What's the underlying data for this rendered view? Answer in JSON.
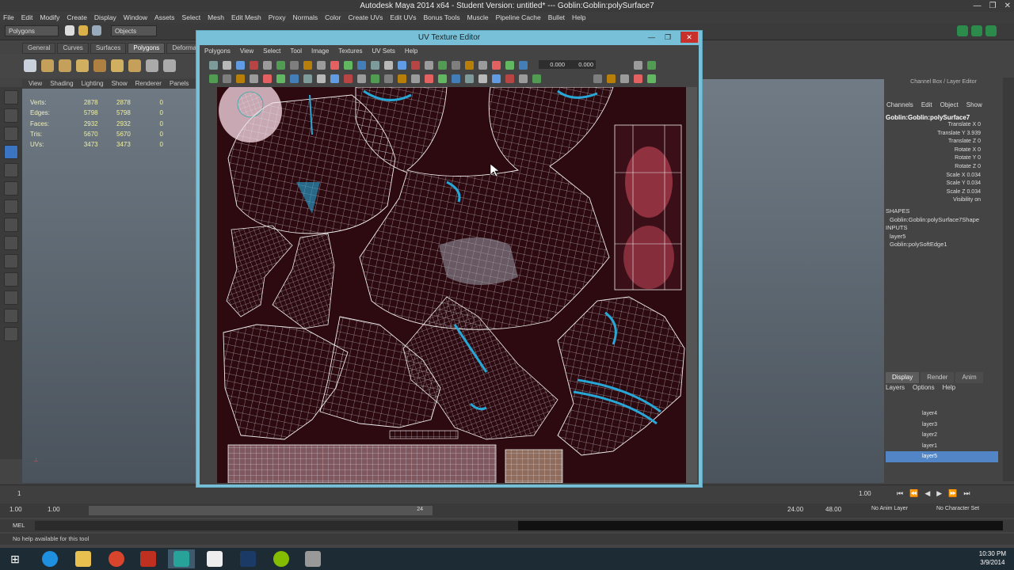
{
  "app": {
    "title": "Autodesk Maya 2014 x64 - Student Version: untitled*   ---   Goblin:Goblin:polySurface7"
  },
  "menubar": [
    "File",
    "Edit",
    "Modify",
    "Create",
    "Display",
    "Window",
    "Assets",
    "Select",
    "Mesh",
    "Edit Mesh",
    "Proxy",
    "Normals",
    "Color",
    "Create UVs",
    "Edit UVs",
    "Bonus Tools",
    "Muscle",
    "Pipeline Cache",
    "Bullet",
    "Help"
  ],
  "statusline": {
    "mode": "Polygons",
    "objects_label": "Objects"
  },
  "shelf_tabs": [
    "General",
    "Curves",
    "Surfaces",
    "Polygons",
    "Deformation"
  ],
  "viewport_menu": [
    "View",
    "Shading",
    "Lighting",
    "Show",
    "Renderer",
    "Panels"
  ],
  "hud": [
    {
      "label": "Verts:",
      "a": "2878",
      "b": "2878",
      "c": "0"
    },
    {
      "label": "Edges:",
      "a": "5798",
      "b": "5798",
      "c": "0"
    },
    {
      "label": "Faces:",
      "a": "2932",
      "b": "2932",
      "c": "0"
    },
    {
      "label": "Tris:",
      "a": "5670",
      "b": "5670",
      "c": "0"
    },
    {
      "label": "UVs:",
      "a": "3473",
      "b": "3473",
      "c": "0"
    }
  ],
  "uv_editor": {
    "title": "UV Texture Editor",
    "menu": [
      "Polygons",
      "View",
      "Select",
      "Tool",
      "Image",
      "Textures",
      "UV Sets",
      "Help"
    ],
    "field_u": "0.000",
    "field_v": "0.000"
  },
  "channel_box": {
    "title": "Channel Box / Layer Editor",
    "menu": [
      "Channels",
      "Edit",
      "Object",
      "Show"
    ],
    "object": "Goblin:Goblin:polySurface7",
    "attributes": [
      {
        "name": "Translate X",
        "value": "0"
      },
      {
        "name": "Translate Y",
        "value": "3.939"
      },
      {
        "name": "Translate Z",
        "value": "0"
      },
      {
        "name": "Rotate X",
        "value": "0"
      },
      {
        "name": "Rotate Y",
        "value": "0"
      },
      {
        "name": "Rotate Z",
        "value": "0"
      },
      {
        "name": "Scale X",
        "value": "0.034"
      },
      {
        "name": "Scale Y",
        "value": "0.034"
      },
      {
        "name": "Scale Z",
        "value": "0.034"
      },
      {
        "name": "Visibility",
        "value": "on"
      }
    ],
    "shapes_header": "SHAPES",
    "shape": "Goblin:Goblin:polySurface7Shape",
    "inputs_header": "INPUTS",
    "inputs": [
      "layer5",
      "Goblin:polySoftEdge1"
    ]
  },
  "layer_editor": {
    "tabs": [
      "Display",
      "Render",
      "Anim"
    ],
    "menu": [
      "Layers",
      "Options",
      "Help"
    ],
    "layers": [
      "layer4",
      "layer3",
      "layer2",
      "layer1",
      "layer5"
    ],
    "selected_index": 4
  },
  "timeline": {
    "start_marker": "1",
    "end_marker": "1.00"
  },
  "range": {
    "start": "1.00",
    "current": "1.00",
    "slider_mid": "24",
    "end": "24.00",
    "max": "48.00",
    "anim_layer": "No Anim Layer",
    "char_set": "No Character Set"
  },
  "cmdline": {
    "label": "MEL"
  },
  "helpline": "No help available for this tool",
  "clock": {
    "time": "10:30 PM",
    "date": "3/9/2014"
  },
  "colors": {
    "accent_blue": "#5285c6",
    "uv_window": "#77c0d8",
    "uv_bg": "#2c0a10",
    "close_red": "#c8302c"
  }
}
